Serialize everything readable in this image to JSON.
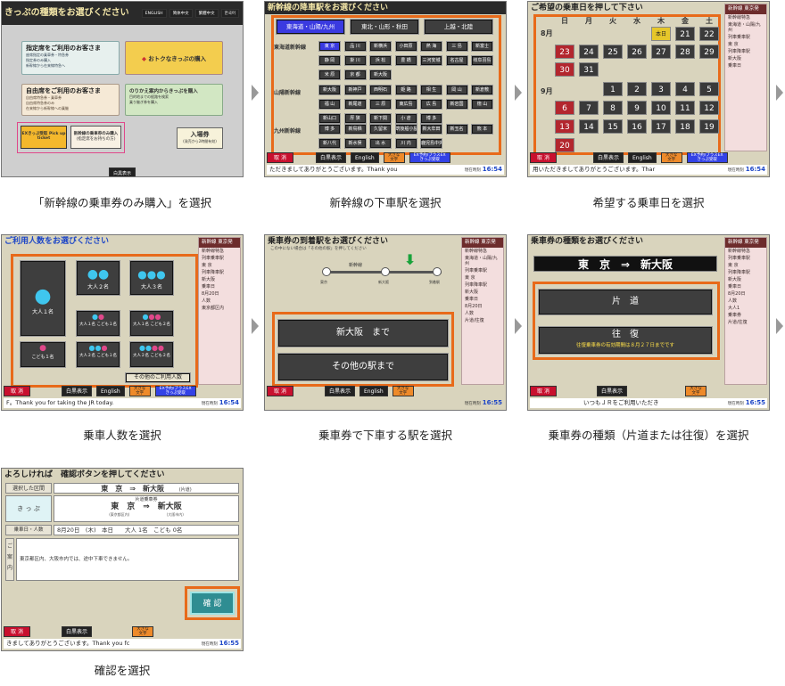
{
  "colors": {
    "accent_orange": "#e86a1a",
    "cancel_red": "#c8102e",
    "title_blue": "#1d46c7",
    "screen_bg": "#d9d4bd"
  },
  "captions": [
    "「新幹線の乗車券のみ購入」を選択",
    "新幹線の下車駅を選択",
    "希望する乗車日を選択",
    "乗車人数を選択",
    "乗車券で下車する駅を選択",
    "乗車券の種類（片道または往復）を選択",
    "確認を選択"
  ],
  "common": {
    "cancel": "取 消",
    "large_text": "白黒表示",
    "english": "English",
    "big_chars": "大きな文字",
    "ex_reserve": "EX予約/プラスEX きっぷ受取",
    "clock_label": "現在時刻",
    "side_head": "新幹線 東京発"
  },
  "s1": {
    "title": "きっぷの種類をお選びください",
    "lang": [
      "ENGLISH",
      "简体中文",
      "繁體中文",
      "한국어"
    ],
    "reserved": "指定席をご利用のお客さま",
    "reserved_lines": [
      "座席指定の乗車券・特急券",
      "指定券のみ購入",
      "新幹線から在来線特急へ"
    ],
    "discount": "おトクなきっぷの購入",
    "unreserved": "自由席をご利用のお客さま",
    "unreserved_lines": [
      "自由席特急券・乗車券",
      "自由席特急券のみ",
      "在来線から新幹線への乗継"
    ],
    "transfer": "のりかえ案内からきっぷを購入",
    "transfer_lines": [
      "目的地までの経路を検索",
      "乗り継ぎ券を購入"
    ],
    "ex": "EXきっぷ受取 Pick up ticket",
    "shinkansen_only": "新幹線の乗車券のみ購入",
    "shinkansen_note": "(指定席をお持ちの方)",
    "admission": "入場券",
    "admission_note": "(発売から2時間有効)",
    "bw": "白黒表示"
  },
  "s2": {
    "title": "新幹線の降車駅をお選びください",
    "tabs": [
      "東海道・山陽/九州",
      "東北・山形・秋田",
      "上越・北陸"
    ],
    "lines": [
      "東海道新幹線",
      "山陽新幹線",
      "九州新幹線"
    ],
    "rows": [
      [
        "東 京",
        "品 川",
        "新横浜",
        "小田原",
        "熱 海",
        "三 島",
        "新富士"
      ],
      [
        "静 岡",
        "掛 川",
        "浜 松",
        "豊 橋",
        "三河安城",
        "名古屋",
        "岐阜羽島"
      ],
      [
        "米 原",
        "京 都",
        "新大阪",
        "",
        "",
        "",
        ""
      ],
      [
        "新大阪",
        "新神戸",
        "西明石",
        "姫 路",
        "相 生",
        "岡 山",
        "新倉敷"
      ],
      [
        "福 山",
        "新尾道",
        "三 原",
        "東広島",
        "広 島",
        "新岩国",
        "徳 山"
      ],
      [
        "新山口",
        "厚 狭",
        "新下関",
        "小 倉",
        "博 多",
        "",
        ""
      ],
      [
        "博 多",
        "新鳥栖",
        "久留米",
        "筑後船小屋",
        "新大牟田",
        "新玉名",
        "熊 本"
      ],
      [
        "新八代",
        "新水俣",
        "出 水",
        "川 内",
        "鹿児島中央",
        "",
        ""
      ]
    ],
    "marquee": "ただきましてありがとうございます。Thank you"
  },
  "s3": {
    "title": "ご希望の乗車日を押して下さい",
    "days": [
      "日",
      "月",
      "火",
      "水",
      "木",
      "金",
      "土"
    ],
    "aug": "8月",
    "sep": "9月",
    "today": "本日",
    "aug_row1": [
      "21",
      "22"
    ],
    "aug_row2": [
      "23",
      "24",
      "25",
      "26",
      "27",
      "28",
      "29"
    ],
    "aug_row3": [
      "30",
      "31"
    ],
    "sep_row1": [
      "1",
      "2",
      "3",
      "4",
      "5"
    ],
    "sep_row2": [
      "6",
      "7",
      "8",
      "9",
      "10",
      "11",
      "12"
    ],
    "sep_row3": [
      "13",
      "14",
      "15",
      "16",
      "17",
      "18",
      "19"
    ],
    "sep_row4": [
      "20"
    ],
    "marquee": "用いただきましてありがとうございます。Thar",
    "side": [
      "新幹線特急",
      "東海道・山陽/九州",
      "列車乗車駅",
      "東 京",
      "列車降車駅",
      "新大阪",
      "乗車日"
    ]
  },
  "s4": {
    "title": "ご利用人数をお選びください",
    "adult1": "大人１名",
    "adult2": "大人２名",
    "adult3": "大人３名",
    "mix1": "大人１名 こども１名",
    "mix2": "大人１名 こども２名",
    "child1": "こども１名",
    "mix3": "大人２名 こども１名",
    "mix4": "大人２名 こども２名",
    "other": "その他のご利用人数",
    "marquee": "F。Thank you for taking the JR today.",
    "side": [
      "新幹線特急",
      "列車乗車駅",
      "東 京",
      "列車降車駅",
      "新大阪",
      "乗車日",
      "8月20日",
      "人数",
      "東京都区内"
    ]
  },
  "s5": {
    "title": "乗車券の到着駅をお選びください",
    "title_hl": "到着駅",
    "sub": "この中にない場合は「その他の駅」を押してください",
    "line": "新幹線",
    "stations": [
      "東京",
      "",
      "新大阪",
      "",
      "到着駅"
    ],
    "to_osaka": "新大阪　まで",
    "other": "その他の駅まで",
    "side": [
      "新幹線特急",
      "東海道・山陽/九州",
      "列車乗車駅",
      "東 京",
      "列車降車駅",
      "新大阪",
      "乗車日",
      "8月20日",
      "人数",
      "片道/往復"
    ]
  },
  "s6": {
    "title": "乗車券の種類をお選びください",
    "title_hl": "種類",
    "route": "東　京　⇒　新大阪",
    "oneway": "片　道",
    "round": "往　復",
    "round_note": "往復乗車券の有効期間は８月２７日までです",
    "marquee": "いつもＪＲをご利用いただき",
    "side": [
      "新幹線特急",
      "列車乗車駅",
      "東 京",
      "列車降車駅",
      "新大阪",
      "乗車日",
      "8月20日",
      "人数",
      "大人1",
      "乗車券",
      "片道/往復"
    ]
  },
  "s7": {
    "title": "よろしければ　確認ボタンを押してください",
    "title_hl": "確認ボタン",
    "section_label": "選択した区間",
    "section": "東　京　⇒　新大阪",
    "section_note": "(片道)",
    "ticket_label": "き っ ぷ",
    "ticket_kind": "片道乗車券",
    "ticket_route": "東　京　⇒　新大阪",
    "ticket_from_note": "(東京都区内)",
    "ticket_to_note": "(大阪市内)",
    "date_label": "乗車日・人数",
    "date_value": "8月20日　(木)　本日　　大人 1名　こども 0名",
    "guide_label": "ご案内",
    "guide_text": "東京都区内、大阪市内では、途中下車できません。",
    "confirm": "確 認",
    "marquee": "きましてありがとうございます。Thank you fc"
  },
  "times": {
    "s2": "16:54",
    "s3": "16:54",
    "s4": "16:54",
    "s5": "16:55",
    "s6": "16:55",
    "s7": "16:55"
  }
}
